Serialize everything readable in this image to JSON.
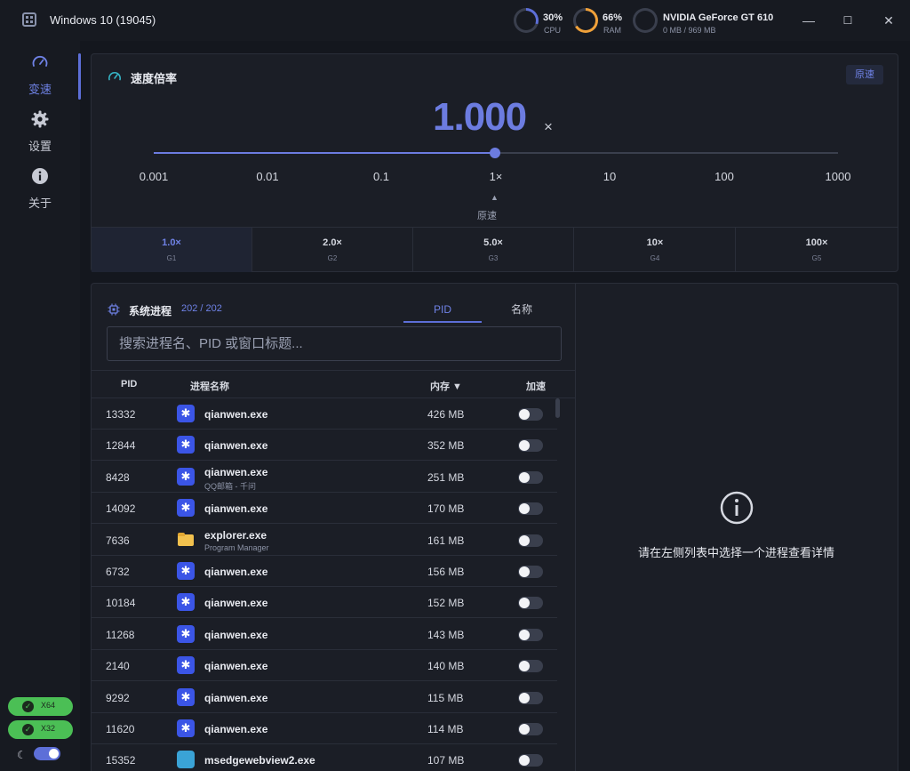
{
  "titlebar": {
    "title": "Windows 10 (19045)",
    "cpu": {
      "value": "30%",
      "label": "CPU",
      "level": 0.3,
      "color": "#5d6fd8"
    },
    "ram": {
      "value": "66%",
      "label": "RAM",
      "level": 0.66,
      "color": "#f0a13a"
    },
    "gpu": {
      "name": "NVIDIA GeForce GT 610",
      "memory": "0 MB / 969 MB",
      "level": 0
    },
    "buttons": {
      "minimize": "—",
      "maximize": "☐",
      "close": "✕"
    }
  },
  "sidebar": {
    "items": [
      {
        "label": "变速",
        "icon": "speedometer-icon",
        "active": true
      },
      {
        "label": "设置",
        "icon": "gear-icon",
        "active": false
      },
      {
        "label": "关于",
        "icon": "info-icon",
        "active": false
      }
    ],
    "badges": [
      {
        "label": "X64",
        "status": "ok"
      },
      {
        "label": "X32",
        "status": "ok"
      }
    ],
    "dark_mode": true
  },
  "speed": {
    "title": "速度倍率",
    "reset_label": "原速",
    "value": "1.000",
    "suffix": "×",
    "slider_position": 0.5,
    "ticks": [
      "0.001",
      "0.01",
      "0.1",
      "1×",
      "10",
      "100",
      "1000"
    ],
    "marker_label": "原速",
    "presets": [
      {
        "value": "1.0×",
        "key": "G1",
        "active": true
      },
      {
        "value": "2.0×",
        "key": "G2",
        "active": false
      },
      {
        "value": "5.0×",
        "key": "G3",
        "active": false
      },
      {
        "value": "10×",
        "key": "G4",
        "active": false
      },
      {
        "value": "100×",
        "key": "G5",
        "active": false
      }
    ]
  },
  "processes": {
    "title": "系统进程",
    "count": "202 / 202",
    "tabs": [
      {
        "label": "PID",
        "active": true
      },
      {
        "label": "名称",
        "active": false
      }
    ],
    "search_placeholder": "搜索进程名、PID 或窗口标题...",
    "columns": {
      "pid": "PID",
      "name": "进程名称",
      "memory": "内存 ▼",
      "accelerate": "加速"
    },
    "rows": [
      {
        "pid": "13332",
        "name": "qianwen.exe",
        "subtitle": "",
        "memory": "426 MB",
        "icon": "qianwen-icon",
        "enabled": false
      },
      {
        "pid": "12844",
        "name": "qianwen.exe",
        "subtitle": "",
        "memory": "352 MB",
        "icon": "qianwen-icon",
        "enabled": false
      },
      {
        "pid": "8428",
        "name": "qianwen.exe",
        "subtitle": "QQ邮箱 - 千问",
        "memory": "251 MB",
        "icon": "qianwen-icon",
        "enabled": false
      },
      {
        "pid": "14092",
        "name": "qianwen.exe",
        "subtitle": "",
        "memory": "170 MB",
        "icon": "qianwen-icon",
        "enabled": false
      },
      {
        "pid": "7636",
        "name": "explorer.exe",
        "subtitle": "Program Manager",
        "memory": "161 MB",
        "icon": "folder-icon",
        "enabled": false
      },
      {
        "pid": "6732",
        "name": "qianwen.exe",
        "subtitle": "",
        "memory": "156 MB",
        "icon": "qianwen-icon",
        "enabled": false
      },
      {
        "pid": "10184",
        "name": "qianwen.exe",
        "subtitle": "",
        "memory": "152 MB",
        "icon": "qianwen-icon",
        "enabled": false
      },
      {
        "pid": "11268",
        "name": "qianwen.exe",
        "subtitle": "",
        "memory": "143 MB",
        "icon": "qianwen-icon",
        "enabled": false
      },
      {
        "pid": "2140",
        "name": "qianwen.exe",
        "subtitle": "",
        "memory": "140 MB",
        "icon": "qianwen-icon",
        "enabled": false
      },
      {
        "pid": "9292",
        "name": "qianwen.exe",
        "subtitle": "",
        "memory": "115 MB",
        "icon": "qianwen-icon",
        "enabled": false
      },
      {
        "pid": "11620",
        "name": "qianwen.exe",
        "subtitle": "",
        "memory": "114 MB",
        "icon": "qianwen-icon",
        "enabled": false
      },
      {
        "pid": "15352",
        "name": "msedgewebview2.exe",
        "subtitle": "",
        "memory": "107 MB",
        "icon": "app-preview-icon",
        "enabled": false
      }
    ]
  },
  "detail": {
    "empty_message": "请在左侧列表中选择一个进程查看详情",
    "icon": "info-circle-icon"
  },
  "colors": {
    "accent": "#5d6fd8",
    "background": "#14171e",
    "panel": "#1b1e26",
    "ok_badge": "#4bbf55"
  }
}
